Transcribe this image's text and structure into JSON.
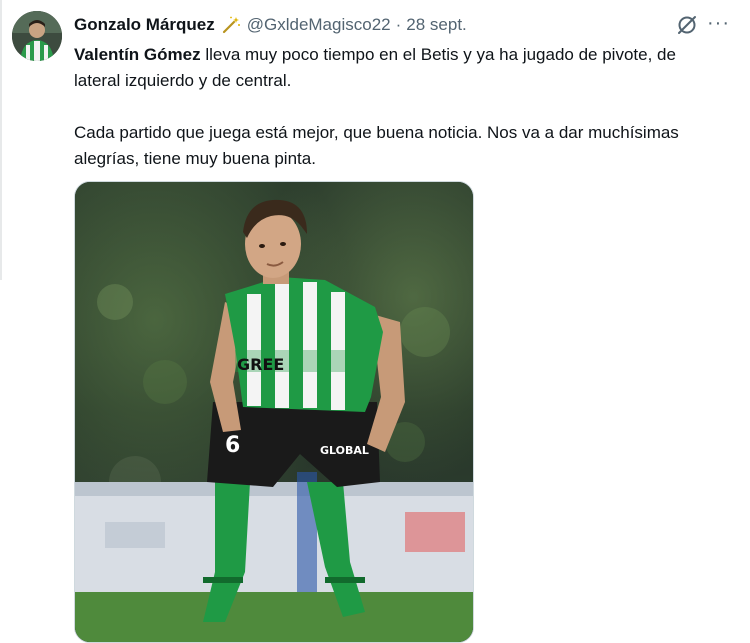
{
  "tweet": {
    "author_name": "Gonzalo Márquez",
    "author_badge_icon": "magic-wand-icon",
    "handle": "@GxldeMagisco22",
    "separator": "·",
    "date": "28 sept.",
    "grok_icon": "grok-icon",
    "more_label": "···",
    "mention": "Valentín Gómez",
    "text_line1_rest": " lleva muy poco tiempo en el Betis y ya ha jugado de pivote, de lateral izquierdo y de central.",
    "text_paragraph2": "Cada partido que juega está mejor, que buena noticia. Nos va a dar muchísimas alegrías, tiene muy buena pinta.",
    "media": {
      "shirt_sponsor": "GREE",
      "shirt_number": "6",
      "shorts_sponsor": "GLOBAL",
      "colors": {
        "green": "#1f9a45",
        "white": "#f4f4f4",
        "black": "#1a1a1a"
      }
    }
  }
}
